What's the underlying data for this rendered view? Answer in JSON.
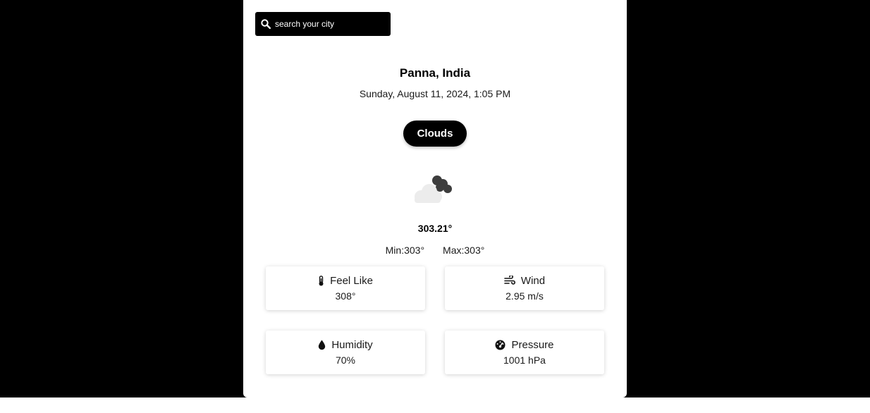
{
  "search": {
    "placeholder": "search your city",
    "icon": "search-icon"
  },
  "location": {
    "city": "Panna, India",
    "datetime": "Sunday, August 11, 2024, 1:05 PM"
  },
  "weather": {
    "condition": "Clouds",
    "icon": "clouds-icon",
    "temperature": "303.21°",
    "min": "Min:303°",
    "max": "Max:303°"
  },
  "stats": [
    {
      "label": "Feel Like",
      "value": "308°",
      "icon": "thermometer-icon"
    },
    {
      "label": "Wind",
      "value": "2.95 m/s",
      "icon": "wind-icon"
    },
    {
      "label": "Humidity",
      "value": "70%",
      "icon": "droplet-icon"
    },
    {
      "label": "Pressure",
      "value": "1001 hPa",
      "icon": "gauge-icon"
    }
  ],
  "colors": {
    "background": "#000000",
    "card": "#ffffff",
    "accent": "#000000"
  }
}
